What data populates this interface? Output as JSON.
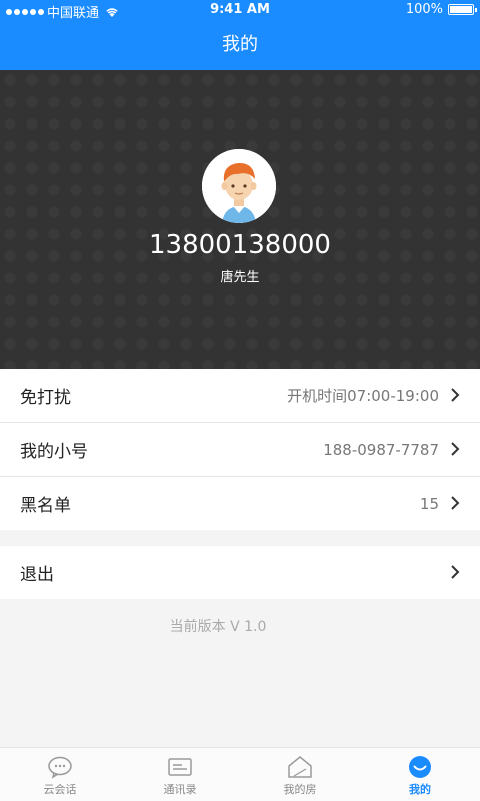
{
  "status_bar": {
    "carrier": "中国联通",
    "time": "9:41 AM",
    "battery": "100%"
  },
  "header": {
    "title": "我的"
  },
  "profile": {
    "phone": "13800138000",
    "name": "唐先生"
  },
  "settings": {
    "dnd": {
      "label": "免打扰",
      "value": "开机时间07:00-19:00"
    },
    "small_number": {
      "label": "我的小号",
      "value": "188-0987-7787"
    },
    "blacklist": {
      "label": "黑名单",
      "value": "15"
    },
    "logout": {
      "label": "退出"
    }
  },
  "version": "当前版本 V 1.0",
  "tabs": [
    {
      "label": "云会话",
      "icon": "chat-bubble-icon"
    },
    {
      "label": "通讯录",
      "icon": "contact-card-icon"
    },
    {
      "label": "我的房",
      "icon": "house-icon"
    },
    {
      "label": "我的",
      "icon": "profile-icon",
      "active": true
    }
  ],
  "colors": {
    "accent": "#1a8cff",
    "profile_bg": "#2b2b2b"
  }
}
